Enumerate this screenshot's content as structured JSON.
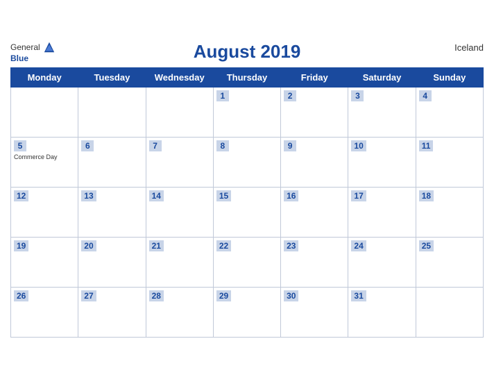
{
  "header": {
    "logo_general": "General",
    "logo_blue": "Blue",
    "title": "August 2019",
    "country": "Iceland"
  },
  "columns": [
    "Monday",
    "Tuesday",
    "Wednesday",
    "Thursday",
    "Friday",
    "Saturday",
    "Sunday"
  ],
  "weeks": [
    [
      {
        "day": "",
        "holiday": ""
      },
      {
        "day": "",
        "holiday": ""
      },
      {
        "day": "",
        "holiday": ""
      },
      {
        "day": "1",
        "holiday": ""
      },
      {
        "day": "2",
        "holiday": ""
      },
      {
        "day": "3",
        "holiday": ""
      },
      {
        "day": "4",
        "holiday": ""
      }
    ],
    [
      {
        "day": "5",
        "holiday": "Commerce Day"
      },
      {
        "day": "6",
        "holiday": ""
      },
      {
        "day": "7",
        "holiday": ""
      },
      {
        "day": "8",
        "holiday": ""
      },
      {
        "day": "9",
        "holiday": ""
      },
      {
        "day": "10",
        "holiday": ""
      },
      {
        "day": "11",
        "holiday": ""
      }
    ],
    [
      {
        "day": "12",
        "holiday": ""
      },
      {
        "day": "13",
        "holiday": ""
      },
      {
        "day": "14",
        "holiday": ""
      },
      {
        "day": "15",
        "holiday": ""
      },
      {
        "day": "16",
        "holiday": ""
      },
      {
        "day": "17",
        "holiday": ""
      },
      {
        "day": "18",
        "holiday": ""
      }
    ],
    [
      {
        "day": "19",
        "holiday": ""
      },
      {
        "day": "20",
        "holiday": ""
      },
      {
        "day": "21",
        "holiday": ""
      },
      {
        "day": "22",
        "holiday": ""
      },
      {
        "day": "23",
        "holiday": ""
      },
      {
        "day": "24",
        "holiday": ""
      },
      {
        "day": "25",
        "holiday": ""
      }
    ],
    [
      {
        "day": "26",
        "holiday": ""
      },
      {
        "day": "27",
        "holiday": ""
      },
      {
        "day": "28",
        "holiday": ""
      },
      {
        "day": "29",
        "holiday": ""
      },
      {
        "day": "30",
        "holiday": ""
      },
      {
        "day": "31",
        "holiday": ""
      },
      {
        "day": "",
        "holiday": ""
      }
    ]
  ]
}
